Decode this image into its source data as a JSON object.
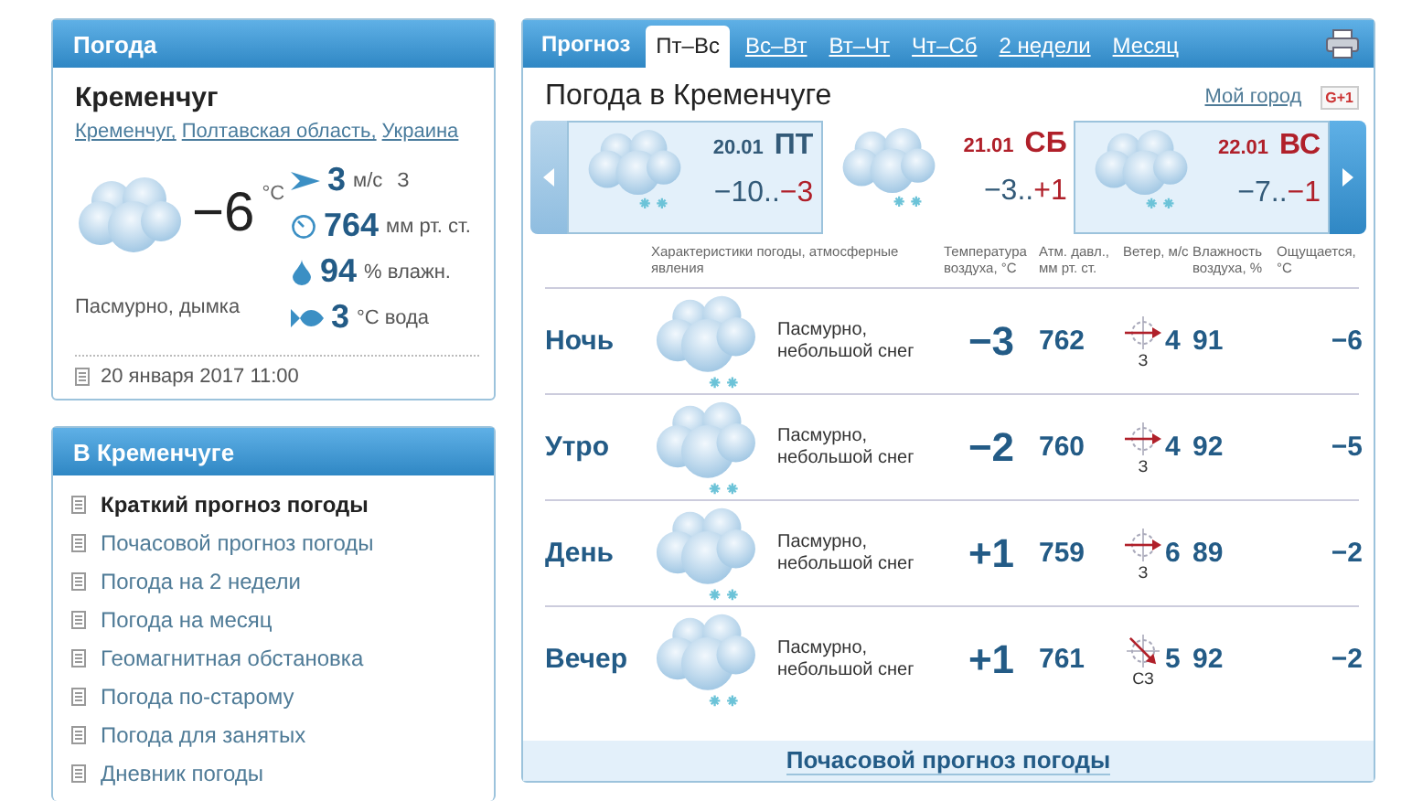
{
  "now": {
    "title": "Погода",
    "city": "Кременчуг",
    "breadcrumbs": [
      "Кременчуг,",
      "Полтавская область,",
      "Украина"
    ],
    "temp": "−6",
    "temp_unit": "°C",
    "condition": "Пасмурно, дымка",
    "stats": [
      {
        "kind": "wind",
        "value": "3",
        "unit": "м/с",
        "extra": "З"
      },
      {
        "kind": "pressure",
        "value": "764",
        "unit": "мм рт. ст."
      },
      {
        "kind": "humidity",
        "value": "94",
        "unit": "% влажн."
      },
      {
        "kind": "water",
        "value": "3",
        "unit": "°C вода"
      }
    ],
    "updated": "20 января 2017 11:00"
  },
  "menu": {
    "title": "В Кременчуге",
    "items": [
      {
        "label": "Краткий прогноз погоды",
        "selected": true
      },
      {
        "label": "Почасовой прогноз погоды",
        "selected": false
      },
      {
        "label": "Погода на 2 недели",
        "selected": false
      },
      {
        "label": "Погода на месяц",
        "selected": false
      },
      {
        "label": "Геомагнитная обстановка",
        "selected": false
      },
      {
        "label": "Погода по-старому",
        "selected": false
      },
      {
        "label": "Погода для занятых",
        "selected": false
      },
      {
        "label": "Дневник погоды",
        "selected": false
      }
    ]
  },
  "forecast": {
    "label": "Прогноз",
    "tabs": [
      {
        "label": "Пт–Вс",
        "selected": true
      },
      {
        "label": "Вс–Вт",
        "selected": false
      },
      {
        "label": "Вт–Чт",
        "selected": false
      },
      {
        "label": "Чт–Сб",
        "selected": false
      },
      {
        "label": "2 недели",
        "selected": false
      },
      {
        "label": "Месяц",
        "selected": false
      }
    ],
    "title": "Погода в Кременчуге",
    "my_city": "Мой город",
    "gplus": "G+1",
    "days": [
      {
        "date": "20.01",
        "weekday": "ПТ",
        "weekend": false,
        "shaded": true,
        "min": "−10..",
        "max": "−3"
      },
      {
        "date": "21.01",
        "weekday": "СБ",
        "weekend": true,
        "shaded": false,
        "min": "−3..",
        "max": "+1"
      },
      {
        "date": "22.01",
        "weekday": "ВС",
        "weekend": true,
        "shaded": true,
        "min": "−7..",
        "max": "−1"
      }
    ],
    "columns": [
      "Характеристики погоды, атмосферные явления",
      "Температура воздуха, °C",
      "Атм. давл., мм рт. ст.",
      "Ветер, м/с",
      "Влажность воздуха, %",
      "Ощущается, °C"
    ],
    "rows": [
      {
        "period": "Ночь",
        "condition": "Пасмурно, небольшой снег",
        "temp": "−3",
        "pressure": "762",
        "wind": "4",
        "wind_dir": "З",
        "kind": "west",
        "humidity": "91",
        "feels": "−6"
      },
      {
        "period": "Утро",
        "condition": "Пасмурно, небольшой снег",
        "temp": "−2",
        "pressure": "760",
        "wind": "4",
        "wind_dir": "З",
        "kind": "west",
        "humidity": "92",
        "feels": "−5"
      },
      {
        "period": "День",
        "condition": "Пасмурно, небольшой снег",
        "temp": "+1",
        "pressure": "759",
        "wind": "6",
        "wind_dir": "З",
        "kind": "west",
        "humidity": "89",
        "feels": "−2"
      },
      {
        "period": "Вечер",
        "condition": "Пасмурно, небольшой снег",
        "temp": "+1",
        "pressure": "761",
        "wind": "5",
        "wind_dir": "СЗ",
        "kind": "northwest",
        "humidity": "92",
        "feels": "−2"
      }
    ],
    "footer_link": "Почасовой прогноз погоды"
  }
}
